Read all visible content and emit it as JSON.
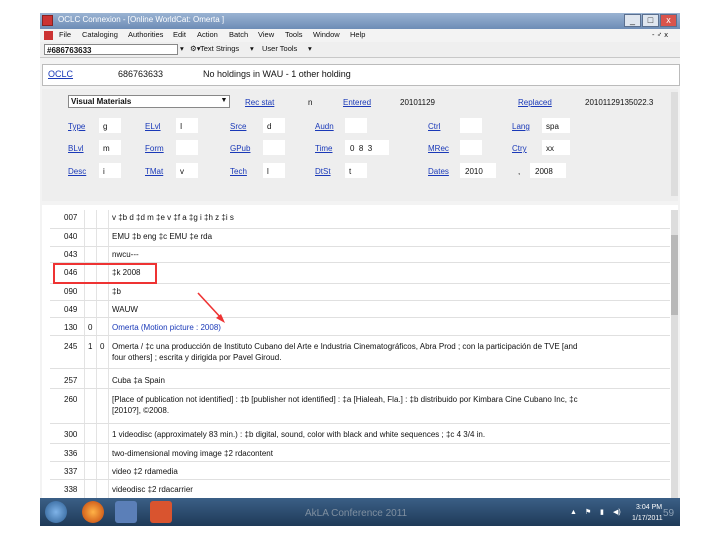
{
  "window": {
    "title": "OCLC Connexion - [Online WorldCat: Omerta ]",
    "buttons": [
      "_",
      "□",
      "x"
    ]
  },
  "menu": {
    "items": [
      "File",
      "Cataloging",
      "Authorities",
      "Edit",
      "Action",
      "Batch",
      "View",
      "Tools",
      "Window",
      "Help"
    ],
    "right": "- ♂ x"
  },
  "toolbar": {
    "search_value": "#686763633",
    "text_strings": "Text Strings",
    "user_tools": "User Tools"
  },
  "infobar": {
    "oclc_label": "OCLC",
    "oclc_number": "686763633",
    "holdings": "No holdings in WAU - 1 other holding"
  },
  "fixed": {
    "format": "Visual Materials",
    "rec_stat_label": "Rec stat",
    "rec_stat": "n",
    "entered_label": "Entered",
    "entered": "20101129",
    "replaced_label": "Replaced",
    "replaced": "20101129135022.3",
    "row1": [
      {
        "label": "Type",
        "value": "g"
      },
      {
        "label": "ELvl",
        "value": "I"
      },
      {
        "label": "Srce",
        "value": "d"
      },
      {
        "label": "Audn",
        "value": ""
      },
      {
        "label": "Ctrl",
        "value": ""
      },
      {
        "label": "Lang",
        "value": "spa"
      }
    ],
    "row2": [
      {
        "label": "BLvl",
        "value": "m"
      },
      {
        "label": "Form",
        "value": ""
      },
      {
        "label": "GPub",
        "value": ""
      },
      {
        "label": "Time",
        "value": "0  8  3"
      },
      {
        "label": "MRec",
        "value": ""
      },
      {
        "label": "Ctry",
        "value": "xx"
      }
    ],
    "row3": [
      {
        "label": "Desc",
        "value": "i"
      },
      {
        "label": "TMat",
        "value": "v"
      },
      {
        "label": "Tech",
        "value": "l"
      },
      {
        "label": "DtSt",
        "value": "t"
      },
      {
        "label": "Dates",
        "value": "2010"
      }
    ],
    "dates_sep": ",",
    "dates2": "2008"
  },
  "fields": [
    {
      "tag": "007",
      "ind1": "",
      "ind2": "",
      "text": "v ‡b d ‡d m ‡e v ‡f a ‡g i ‡h z ‡i s"
    },
    {
      "tag": "040",
      "ind1": "",
      "ind2": "",
      "text": "EMU ‡b eng ‡c EMU ‡e rda"
    },
    {
      "tag": "043",
      "ind1": "",
      "ind2": "",
      "text": "nwcu---"
    },
    {
      "tag": "046",
      "ind1": "",
      "ind2": "",
      "text": "‡k 2008"
    },
    {
      "tag": "090",
      "ind1": "",
      "ind2": "",
      "text": "‡b"
    },
    {
      "tag": "049",
      "ind1": "",
      "ind2": "",
      "text": "WAUW"
    },
    {
      "tag": "130",
      "ind1": "0",
      "ind2": "",
      "text": "Omerta (Motion picture : 2008)"
    },
    {
      "tag": "245",
      "ind1": "1",
      "ind2": "0",
      "text": "Omerta / ‡c una producción de Instituto Cubano del Arte e Industria Cinematográficos, Abra Prod ; con la participación de TVE [and",
      "text2": "four others] ; escrita y dirigida por Pavel Giroud."
    },
    {
      "tag": "257",
      "ind1": "",
      "ind2": "",
      "text": "Cuba ‡a Spain"
    },
    {
      "tag": "260",
      "ind1": "",
      "ind2": "",
      "text": "[Place of publication not identified] : ‡b [publisher not identified] : ‡a [Hialeah, Fla.] : ‡b distribuido por Kimbara Cine Cubano Inc, ‡c",
      "text2": "[2010?], ©2008."
    },
    {
      "tag": "300",
      "ind1": "",
      "ind2": "",
      "text": "1 videodisc (approximately 83 min.) : ‡b digital, sound, color with black and white sequences ; ‡c 4 3/4 in."
    },
    {
      "tag": "336",
      "ind1": "",
      "ind2": "",
      "text": "two-dimensional moving image ‡2 rdacontent"
    },
    {
      "tag": "337",
      "ind1": "",
      "ind2": "",
      "text": "video ‡2 rdamedia"
    },
    {
      "tag": "338",
      "ind1": "",
      "ind2": "",
      "text": "videodisc ‡2 rdacarrier"
    }
  ],
  "footer": {
    "conference": "AkLA Conference 2011",
    "time": "3:04 PM",
    "date": "1/17/2011",
    "page": "59"
  },
  "colors": {
    "link": "#1a39b8",
    "highlight": "#e33333",
    "taskbar": "#1f3a58"
  }
}
